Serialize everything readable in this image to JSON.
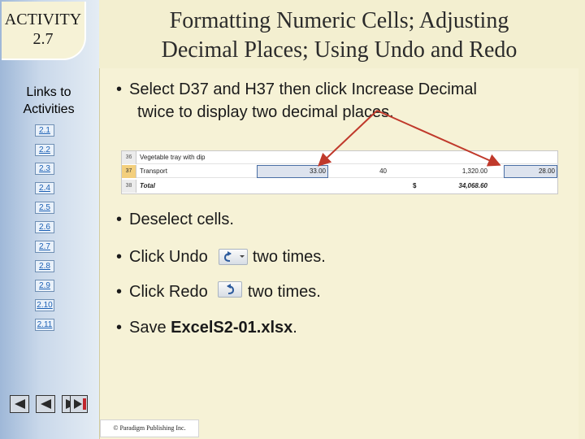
{
  "sidebar": {
    "activity_line1": "ACTIVITY",
    "activity_line2": "2.7",
    "links_title_line1": "Links to",
    "links_title_line2": "Activities",
    "links": [
      "2.1",
      "2.2",
      "2.3",
      "2.4",
      "2.5",
      "2.6",
      "2.7",
      "2.8",
      "2.9",
      "2.10",
      "2.11"
    ]
  },
  "title": {
    "line1": "Formatting Numeric Cells; Adjusting",
    "line2": "Decimal Places; Using Undo and Redo"
  },
  "content": {
    "bullet1_line1": "Select D37 and H37 then click Increase Decimal",
    "bullet1_line2": "twice to display two decimal places.",
    "bullet2": "Deselect cells.",
    "bullet3_pre": "Click Undo",
    "bullet3_post": "two times.",
    "bullet4_pre": "Click Redo",
    "bullet4_post": "two times.",
    "bullet5_pre": "Save",
    "bullet5_file": "ExcelS2-01.xlsx",
    "bullet5_post": "."
  },
  "spreadsheet": {
    "rows": [
      {
        "num": "36",
        "label": "Vegetable tray with dip",
        "d": "",
        "f": "",
        "g": "",
        "h": ""
      },
      {
        "num": "37",
        "label": "Transport",
        "d": "33.00",
        "f": "40",
        "g": "1,320.00",
        "h": "28.00"
      },
      {
        "num": "38",
        "label": "Total",
        "d": "",
        "f": "$",
        "g": "34,068.60",
        "h": ""
      }
    ]
  },
  "footer": {
    "copyright": "© Paradigm Publishing Inc."
  },
  "colors": {
    "background": "#f3efd0",
    "sidebar": "#b9cde4",
    "arrow": "#c0392b"
  }
}
